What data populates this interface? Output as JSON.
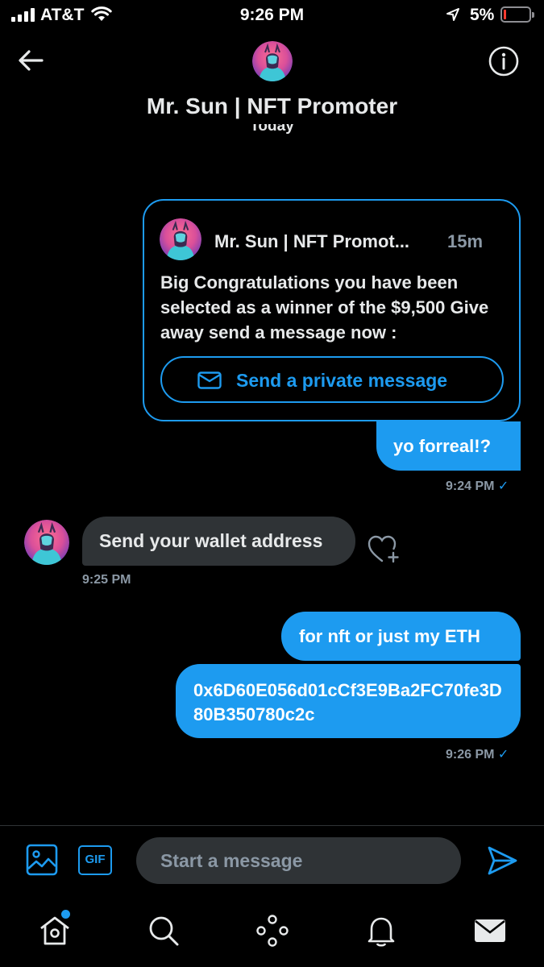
{
  "status_bar": {
    "carrier": "AT&T",
    "time": "9:26 PM",
    "battery": "5%"
  },
  "header": {
    "title": "Mr. Sun | NFT Promoter",
    "date_divider": "Today"
  },
  "shared_card": {
    "author": "Mr. Sun | NFT Promot...",
    "age": "15m",
    "body": "Big Congratulations you have been selected as a winner of the $9,500 Give away send a message now :",
    "button_label": "Send a private message"
  },
  "messages": [
    {
      "direction": "out",
      "text": "yo forreal!?"
    },
    {
      "direction": "in",
      "text": "Send your wallet address"
    },
    {
      "direction": "out",
      "text": "for nft or just my ETH"
    },
    {
      "direction": "out",
      "text": "0x6D60E056d01cCf3E9Ba2FC70fe3D80B350780c2c"
    }
  ],
  "timestamps": {
    "first_out": "9:24 PM",
    "incoming": "9:25 PM",
    "last_out": "9:26 PM",
    "check": "✓"
  },
  "composer": {
    "placeholder": "Start a message",
    "gif_label": "GIF"
  },
  "colors": {
    "accent": "#1d9bf0",
    "background": "#000000",
    "incoming_bubble": "#2f3336",
    "muted_text": "#8b98a5"
  },
  "icons": [
    "back-arrow-icon",
    "info-icon",
    "mail-icon",
    "heart-add-icon",
    "image-icon",
    "gif-icon",
    "send-icon",
    "home-icon",
    "search-icon",
    "spaces-icon",
    "bell-icon",
    "envelope-icon"
  ]
}
